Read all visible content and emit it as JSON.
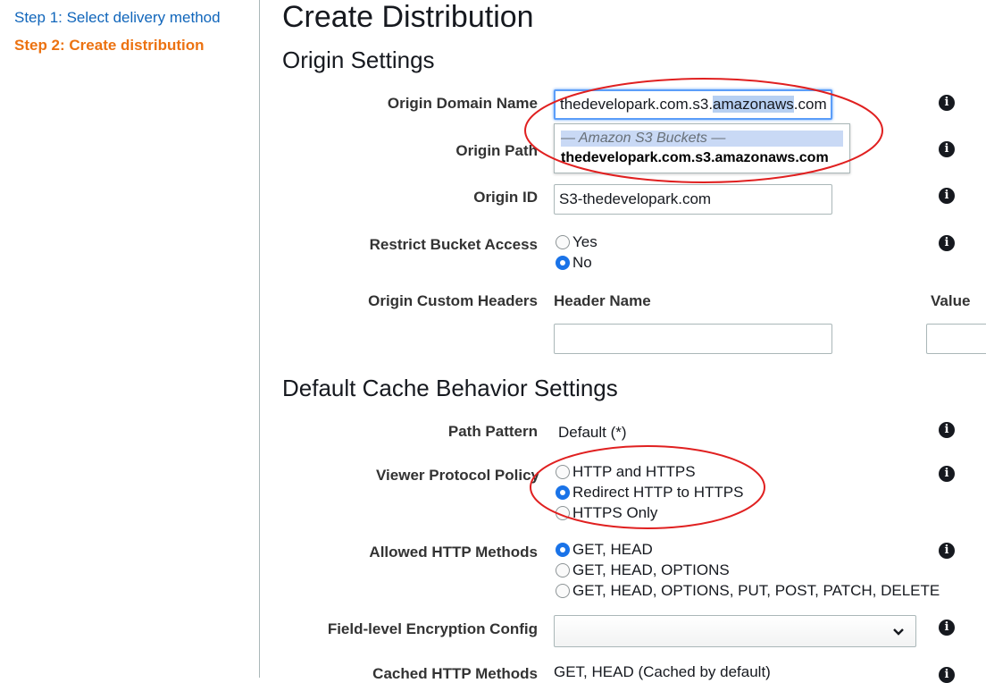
{
  "sidebar": {
    "steps": [
      {
        "label": "Step 1: Select delivery method"
      },
      {
        "label": "Step 2: Create distribution"
      }
    ]
  },
  "page_title": "Create Distribution",
  "origin": {
    "heading": "Origin Settings",
    "domain_name": {
      "label": "Origin Domain Name",
      "value_prefix": "thedevelopark.com.s3.",
      "value_selected": "amazonaws",
      "value_suffix": ".com",
      "dropdown_group": "— Amazon S3 Buckets —",
      "dropdown_item": "thedevelopark.com.s3.amazonaws.com"
    },
    "path": {
      "label": "Origin Path"
    },
    "origin_id": {
      "label": "Origin ID",
      "value": "S3-thedevelopark.com"
    },
    "restrict_bucket": {
      "label": "Restrict Bucket Access",
      "options": [
        "Yes",
        "No"
      ],
      "selected": "No"
    },
    "custom_headers": {
      "label": "Origin Custom Headers",
      "col_name": "Header Name",
      "col_value": "Value"
    }
  },
  "cache": {
    "heading": "Default Cache Behavior Settings",
    "path_pattern": {
      "label": "Path Pattern",
      "value": "Default (*)"
    },
    "viewer_protocol": {
      "label": "Viewer Protocol Policy",
      "options": [
        "HTTP and HTTPS",
        "Redirect HTTP to HTTPS",
        "HTTPS Only"
      ],
      "selected": "Redirect HTTP to HTTPS"
    },
    "allowed_methods": {
      "label": "Allowed HTTP Methods",
      "options": [
        "GET, HEAD",
        "GET, HEAD, OPTIONS",
        "GET, HEAD, OPTIONS, PUT, POST, PATCH, DELETE"
      ],
      "selected": "GET, HEAD"
    },
    "fle_config": {
      "label": "Field-level Encryption Config",
      "value": ""
    },
    "cached_methods": {
      "label": "Cached HTTP Methods",
      "value": "GET, HEAD (Cached by default)"
    }
  },
  "icons": {
    "info": "info-icon",
    "chevron": "chevron-down-icon"
  },
  "colors": {
    "link": "#1166bb",
    "active_step": "#ec7211",
    "radio_checked": "#1a73e8",
    "focus_border": "#5b9df9",
    "annotation": "#e02020"
  }
}
